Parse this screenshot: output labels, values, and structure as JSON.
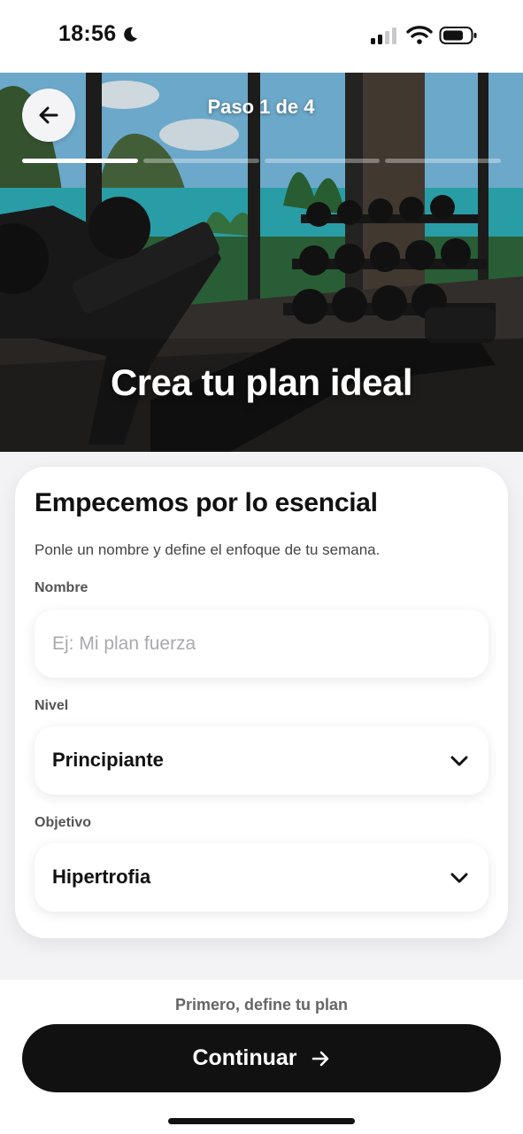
{
  "status_bar": {
    "time": "18:56",
    "icons": [
      "moon-icon",
      "signal-icon",
      "wifi-icon",
      "battery-icon"
    ]
  },
  "header": {
    "step_label": "Paso 1 de 4",
    "progress": {
      "current_step": 1,
      "total_steps": 4
    },
    "hero_title": "Crea tu plan ideal",
    "back_icon": "arrow-left-icon"
  },
  "form": {
    "title": "Empecemos por lo esencial",
    "subtitle": "Ponle un nombre y define el enfoque de tu semana.",
    "name": {
      "label": "Nombre",
      "value": "",
      "placeholder": "Ej: Mi plan fuerza"
    },
    "level": {
      "label": "Nivel",
      "value": "Principiante"
    },
    "goal": {
      "label": "Objetivo",
      "value": "Hipertrofia"
    }
  },
  "footer": {
    "hint": "Primero, define tu plan",
    "continue_label": "Continuar",
    "continue_icon": "arrow-right-icon"
  },
  "colors": {
    "primary_button": "#111111",
    "card_background": "#ffffff",
    "page_background": "#f3f3f5"
  }
}
